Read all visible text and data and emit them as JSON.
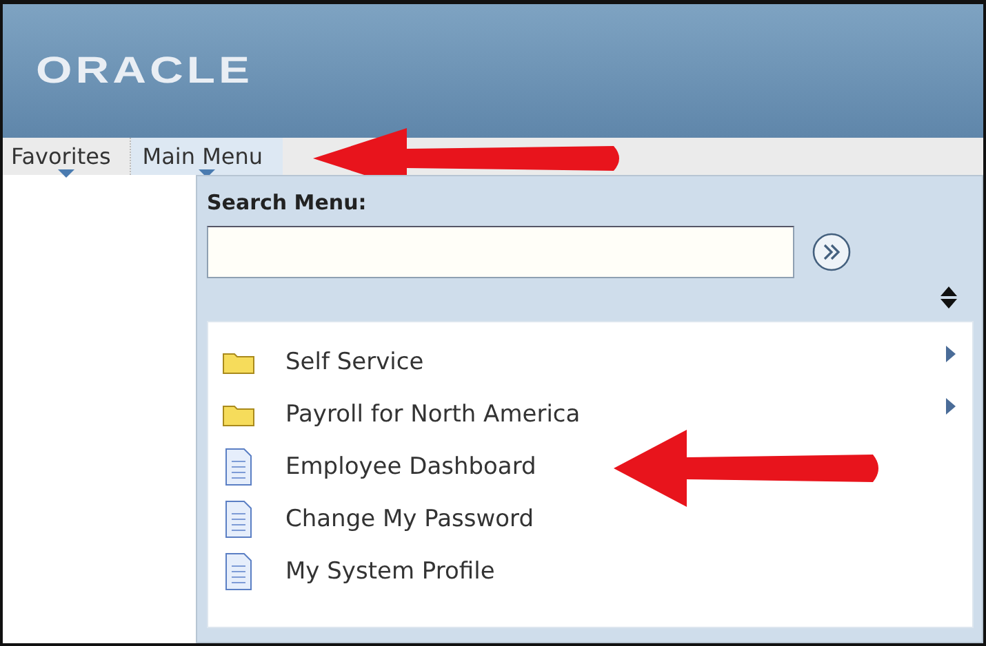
{
  "header": {
    "logo": "ORACLE"
  },
  "menu_bar": [
    {
      "label": "Favorites",
      "selected": false,
      "arrow": false
    },
    {
      "label": "Main Menu",
      "selected": true,
      "arrow": true
    }
  ],
  "dropdown": {
    "search_label": "Search Menu:",
    "items": [
      {
        "label": "Self Service",
        "kind": "folder",
        "submenu": true,
        "arrow": false
      },
      {
        "label": "Payroll for North America",
        "kind": "folder",
        "submenu": true,
        "arrow": false
      },
      {
        "label": "Employee Dashboard",
        "kind": "page",
        "submenu": false,
        "arrow": true
      },
      {
        "label": "Change My Password",
        "kind": "page",
        "submenu": false,
        "arrow": false
      },
      {
        "label": "My System Profile",
        "kind": "page",
        "submenu": false,
        "arrow": false
      }
    ]
  }
}
